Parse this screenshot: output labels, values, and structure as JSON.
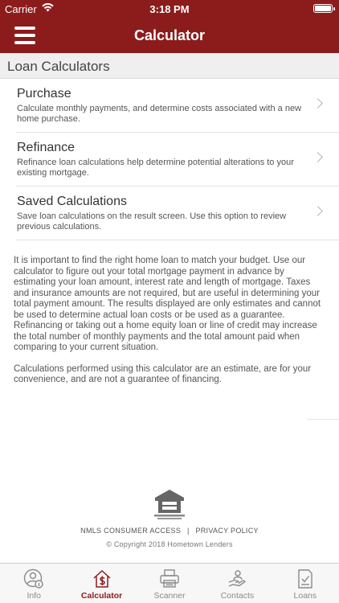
{
  "status_bar": {
    "carrier": "Carrier",
    "time": "3:18 PM"
  },
  "nav": {
    "title": "Calculator",
    "menu_icon": "hamburger-menu-icon"
  },
  "section": {
    "title": "Loan Calculators"
  },
  "items": [
    {
      "title": "Purchase",
      "description": "Calculate monthly payments, and determine costs associated with a new home purchase."
    },
    {
      "title": "Refinance",
      "description": "Refinance loan calculations help determine potential alterations to your existing mortgage."
    },
    {
      "title": "Saved Calculations",
      "description": "Save loan calculations on the result screen. Use this option to review previous calculations."
    }
  ],
  "info": {
    "paragraph1": "It is important to find the right home loan to match your budget. Use our calculator to figure out your total mortgage payment in advance by estimating your loan amount, interest rate and length of mortgage. Taxes and insurance amounts are not required, but are useful in determining your total payment amount.  The results displayed are only estimates and cannot be used to determine actual loan costs or be used as a guarantee. Refinancing or taking out a home equity loan or line of credit may increase the total number of monthly payments and the total amount paid when comparing to your current situation.",
    "paragraph2": "Calculations performed using this calculator are an estimate, are for your convenience, and are not a guarantee of financing."
  },
  "footer": {
    "logo_text": "EQUAL HOUSING OPPORTUNITY",
    "nmls_link": "NMLS CONSUMER ACCESS",
    "separator": "|",
    "privacy_link": "PRIVACY POLICY",
    "copyright": "© Copyright 2018 Hometown Lenders"
  },
  "tabs": [
    {
      "label": "Info",
      "icon": "person-info-icon",
      "active": false
    },
    {
      "label": "Calculator",
      "icon": "house-dollar-icon",
      "active": true
    },
    {
      "label": "Scanner",
      "icon": "scanner-icon",
      "active": false
    },
    {
      "label": "Contacts",
      "icon": "contacts-icon",
      "active": false
    },
    {
      "label": "Loans",
      "icon": "loan-document-icon",
      "active": false
    }
  ],
  "colors": {
    "brand": "#8c1c1c",
    "tab_inactive": "#8a8a8a",
    "section_bg": "#efefef"
  }
}
